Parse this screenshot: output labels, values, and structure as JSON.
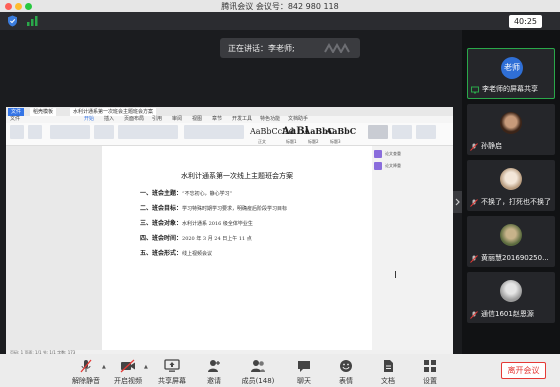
{
  "window": {
    "title": "腾讯会议 会议号：842 980 118"
  },
  "topbar": {
    "timer": "40:25",
    "speaking": "正在讲话：李老师;"
  },
  "shared_doc": {
    "tabs": [
      "文件",
      "稻壳模板",
      "水利计通系第一次班会主题班会方案"
    ],
    "menu": [
      "文件",
      "开始",
      "插入",
      "页面布局",
      "引用",
      "审阅",
      "视图",
      "章节",
      "开发工具",
      "特色功能",
      "文档助手"
    ],
    "styles": [
      {
        "sample": "AaBbCcDd",
        "label": "正文"
      },
      {
        "sample": "AaBl",
        "label": "标题1"
      },
      {
        "sample": "AaBbC",
        "label": "标题2"
      },
      {
        "sample": "AaBbC",
        "label": "标题3"
      }
    ],
    "title": "水利计通系第一次线上主题班会方案",
    "lines": [
      {
        "label": "一、班会主题：",
        "value": "“不忘初心，静心学习”"
      },
      {
        "label": "二、班会目标：",
        "value": "学习特殊时期学习要求，明确疫后阶段学习目标"
      },
      {
        "label": "三、班会对象：",
        "value": "水利计通系 2016 级全体毕业生"
      },
      {
        "label": "四、班会时间：",
        "value": "2020 年 3 月 24 日上午 11 点"
      },
      {
        "label": "五、班会形式：",
        "value": "线上视频会议"
      }
    ],
    "side_buttons": [
      "论文查重",
      "论文降重"
    ],
    "status": "页码: 1  页面: 1/1  节: 1/1  字数: 173"
  },
  "participants": [
    {
      "name": "李老师的屏幕共享",
      "avatar_text": "老师",
      "avatar_color": "#2f6fd6",
      "active": true
    },
    {
      "name": "孙静启",
      "avatar_color": "#5a3b2a",
      "active": false
    },
    {
      "name": "不换了，打死也不换了",
      "avatar_color": "#d9c2a8",
      "active": false
    },
    {
      "name": "黄丽慧201690250...",
      "avatar_color": "#7a8a5a",
      "active": false
    },
    {
      "name": "通信1601赵恩源",
      "avatar_color": "#9a9a9a",
      "active": false
    }
  ],
  "toolbar": {
    "items": [
      {
        "name": "unmute",
        "label": "解除静音"
      },
      {
        "name": "video",
        "label": "开启视频"
      },
      {
        "name": "share",
        "label": "共享屏幕"
      },
      {
        "name": "invite",
        "label": "邀请"
      },
      {
        "name": "members",
        "label": "成员(148)"
      },
      {
        "name": "chat",
        "label": "聊天"
      },
      {
        "name": "emoji",
        "label": "表情"
      },
      {
        "name": "docs",
        "label": "文档"
      },
      {
        "name": "settings",
        "label": "设置"
      }
    ],
    "leave": "离开会议"
  },
  "colors": {
    "accent_green": "#2aa84a",
    "leave_red": "#e53935",
    "avatar_blue": "#2f6fd6"
  }
}
